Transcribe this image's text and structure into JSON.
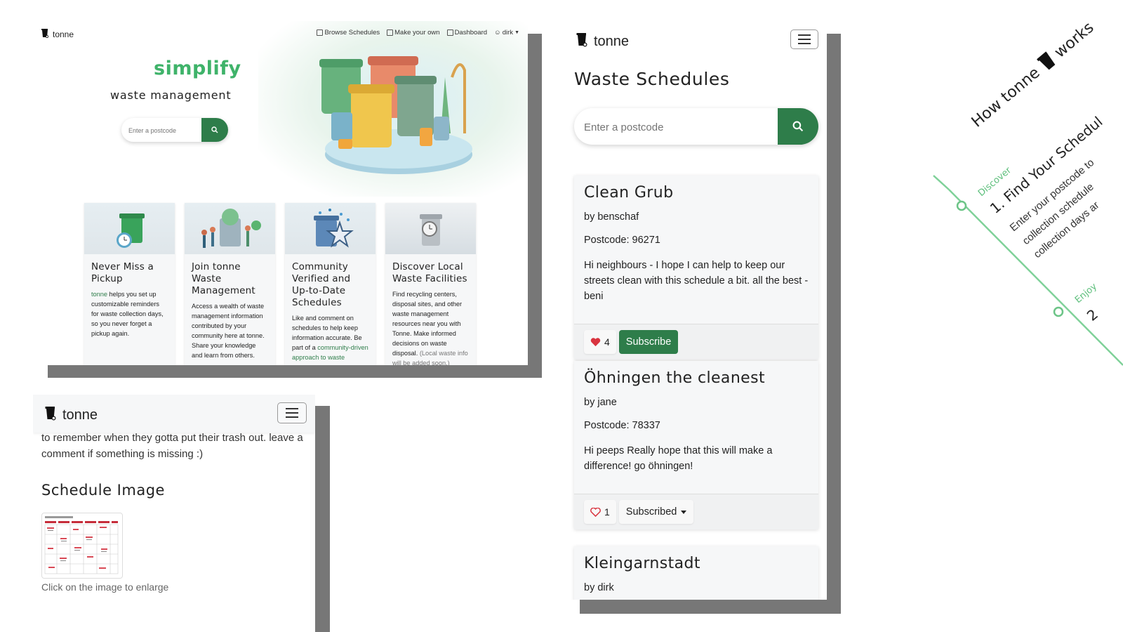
{
  "brand": {
    "name": "tonne"
  },
  "desktop": {
    "nav": {
      "browse": "Browse Schedules",
      "make": "Make your own",
      "dashboard": "Dashboard",
      "user": "dirk"
    },
    "hero": {
      "headline": "simplify",
      "subheadline": "waste management",
      "search_placeholder": "Enter a postcode"
    },
    "cards": [
      {
        "title": "Never Miss a Pickup",
        "brand": "tonne",
        "text": " helps you set up customizable reminders for waste collection days, so you never forget a pickup again."
      },
      {
        "title": "Join tonne Waste Management",
        "text": "Access a wealth of waste management information contributed by your community here at tonne. Share your knowledge and learn from others."
      },
      {
        "title": "Community Verified and Up-to-Date Schedules",
        "text": "Like and comment on schedules to help keep information accurate. Be part of a ",
        "link": "community-driven approach to waste"
      },
      {
        "title": "Discover Local Waste Facilities",
        "text": "Find recycling centers, disposal sites, and other waste management resources near you with Tonne. Make informed decisions on waste disposal. ",
        "muted": "(Local waste info will be added soon.)"
      }
    ]
  },
  "detail": {
    "content": "to remember when they gotta put their trash out. leave a comment if something is missing :)",
    "image_heading": "Schedule Image",
    "caption": "Click on the image to enlarge"
  },
  "schedules": {
    "heading": "Waste Schedules",
    "search_placeholder": "Enter a postcode",
    "items": [
      {
        "title": "Clean Grub",
        "author": "by benschaf",
        "postcode": "Postcode: 96271",
        "description": "Hi neighbours - I hope I can help to keep our streets clean with this schedule a bit. all the best - beni",
        "likes": "4",
        "liked": true,
        "action": "Subscribe"
      },
      {
        "title": "Öhningen the cleanest",
        "author": "by jane",
        "postcode": "Postcode: 78337",
        "description": "Hi peeps Really hope that this will make a difference! go öhningen!",
        "likes": "1",
        "liked": false,
        "action": "Subscribed"
      },
      {
        "title": "Kleingarnstadt",
        "author": "by dirk"
      }
    ]
  },
  "howitworks": {
    "title_part1": "How tonne",
    "title_part2": "works",
    "step1_tag": "Discover",
    "step1_title": "1. Find Your Schedul",
    "step1_text_line1": "Enter your postcode to",
    "step1_text_line2": "collection schedule",
    "step1_text_line3": "collection days ar",
    "step2_tag": "Enjoy",
    "step2_title": "2"
  },
  "colors": {
    "accent": "#2e7d4a",
    "headline_green": "#3fb36a",
    "heart": "#d9343f"
  },
  "icons": [
    "trash-icon",
    "map-icon",
    "plus-square-icon",
    "dashboard-icon",
    "user-icon",
    "search-icon",
    "menu-icon",
    "heart-icon",
    "caret-down-icon"
  ]
}
